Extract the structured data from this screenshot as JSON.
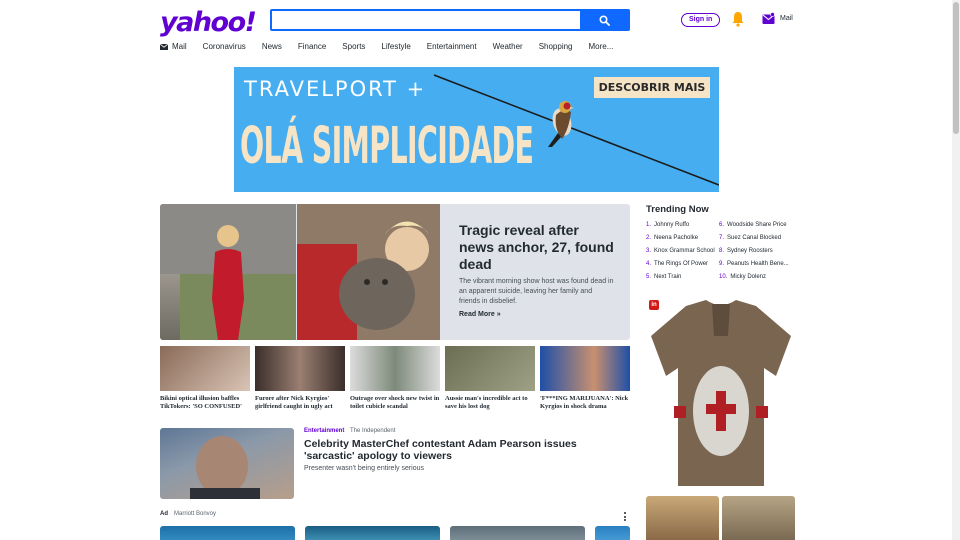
{
  "header": {
    "logo": "yahoo!",
    "search_placeholder": "",
    "signin": "Sign in",
    "mail": "Mail"
  },
  "nav": [
    {
      "label": "Mail",
      "icon": "mail-icon"
    },
    {
      "label": "Coronavirus"
    },
    {
      "label": "News"
    },
    {
      "label": "Finance"
    },
    {
      "label": "Sports"
    },
    {
      "label": "Lifestyle"
    },
    {
      "label": "Entertainment"
    },
    {
      "label": "Weather"
    },
    {
      "label": "Shopping"
    },
    {
      "label": "More..."
    }
  ],
  "banner": {
    "brand": "TRAVELPORT +",
    "cta": "DESCOBRIR MAIS",
    "headline": "OLÁ SIMPLICIDADE",
    "background": "#46aef0"
  },
  "hero": {
    "title": "Tragic reveal after news anchor, 27, found dead",
    "description": "The vibrant morning show host was found dead in an apparent suicide, leaving her family and friends in disbelief.",
    "read_more": "Read More »"
  },
  "stories": [
    {
      "caption": "Bikini optical illusion baffles TikTokers: 'SO CONFUSED'",
      "colors": [
        "#8a6a58",
        "#d9c4b5"
      ]
    },
    {
      "caption": "Furore after Nick Kyrgios' girlfriend caught in ugly act",
      "colors": [
        "#3a2e2a",
        "#9a7f72"
      ]
    },
    {
      "caption": "Outrage over shock new twist in toilet cubicle scandal",
      "colors": [
        "#dcdcdc",
        "#7d8a7a"
      ]
    },
    {
      "caption": "Aussie man's incredible act to save his lost dog",
      "colors": [
        "#6b6e52",
        "#9fa187"
      ]
    },
    {
      "caption": "'F***ING MARIJUANA': Nick Kyrgios in shock drama",
      "colors": [
        "#1f4fa8",
        "#c89070"
      ]
    }
  ],
  "featured": {
    "category": "Entertainment",
    "source": "The Independent",
    "title": "Celebrity MasterChef contestant Adam Pearson issues 'sarcastic' apology to viewers",
    "description": "Presenter wasn't being entirely serious"
  },
  "ad": {
    "label": "Ad",
    "sponsor": "Marriott Bonvoy"
  },
  "trending": {
    "title": "Trending Now",
    "items": [
      {
        "num": "1.",
        "label": "Johnny Ruffo"
      },
      {
        "num": "2.",
        "label": "Neena Pacholke"
      },
      {
        "num": "3.",
        "label": "Knox Grammar School"
      },
      {
        "num": "4.",
        "label": "The Rings Of Power"
      },
      {
        "num": "5.",
        "label": "Next Train"
      },
      {
        "num": "6.",
        "label": "Woodside Share Price"
      },
      {
        "num": "7.",
        "label": "Suez Canal Blocked"
      },
      {
        "num": "8.",
        "label": "Sydney Roosters"
      },
      {
        "num": "9.",
        "label": "Peanuts Health Bene..."
      },
      {
        "num": "10.",
        "label": "Micky Dolenz"
      }
    ]
  },
  "colors": {
    "brand": "#6001d2",
    "search_blue": "#0f69ff",
    "bell": "#ffa700"
  }
}
